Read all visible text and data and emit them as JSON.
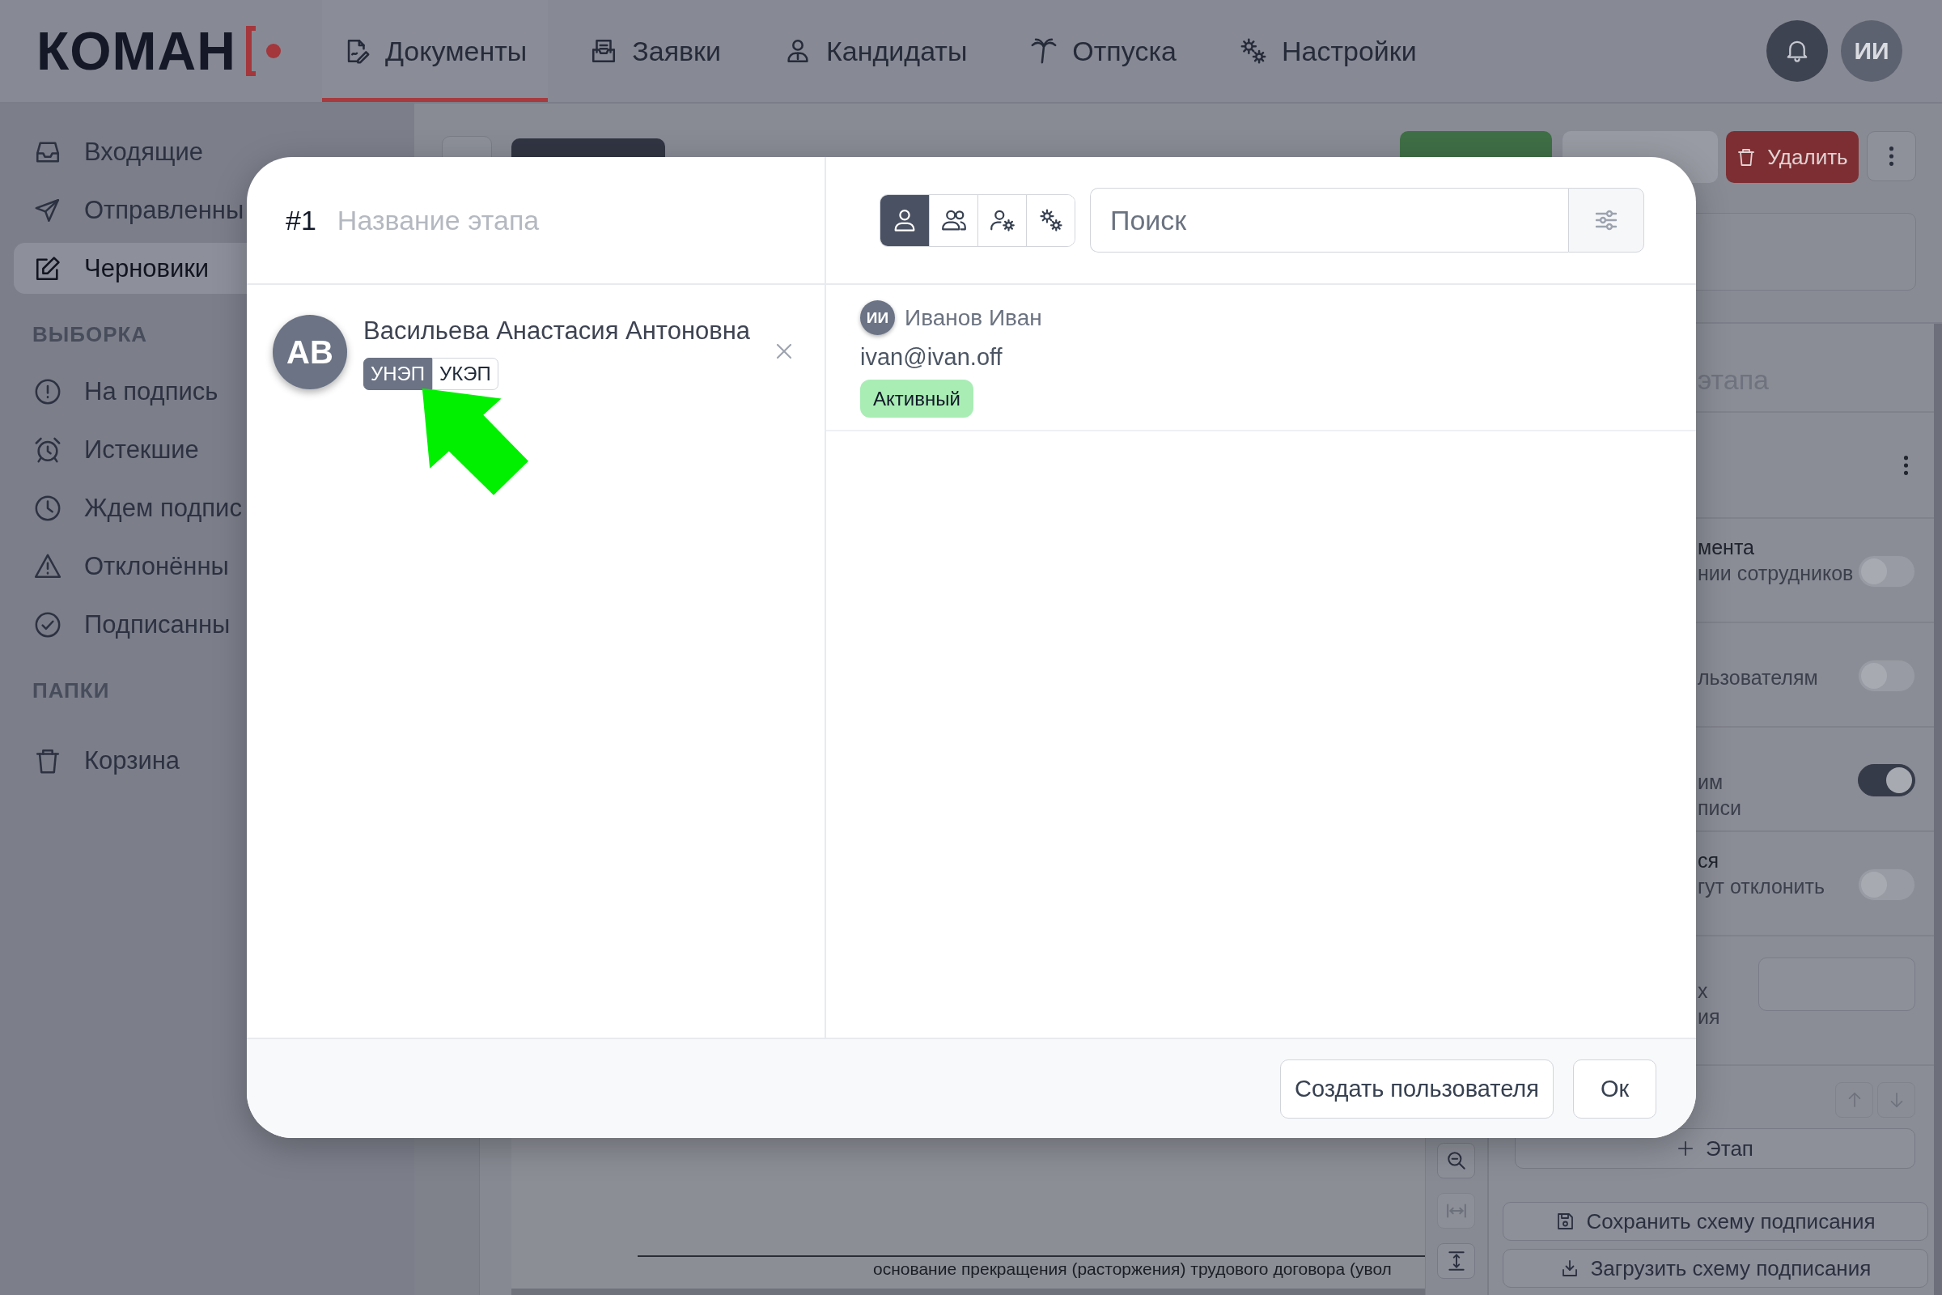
{
  "topbar": {
    "logo": "КОМАН",
    "nav": [
      {
        "label": "Документы",
        "selected": true
      },
      {
        "label": "Заявки",
        "selected": false
      },
      {
        "label": "Кандидаты",
        "selected": false
      },
      {
        "label": "Отпуска",
        "selected": false
      },
      {
        "label": "Настройки",
        "selected": false
      }
    ],
    "avatar": "ИИ"
  },
  "sidebar": {
    "groups": [
      {
        "items": [
          {
            "label": "Входящие",
            "selected": false
          },
          {
            "label": "Отправленны",
            "selected": false
          },
          {
            "label": "Черновики",
            "selected": true
          }
        ]
      },
      {
        "heading": "ВЫБОРКА",
        "items": [
          {
            "label": "На подпись",
            "selected": false
          },
          {
            "label": "Истекшие",
            "selected": false
          },
          {
            "label": "Ждем подпис",
            "selected": false
          },
          {
            "label": "Отклонённы",
            "selected": false
          },
          {
            "label": "Подписанны",
            "selected": false
          }
        ]
      },
      {
        "heading": "ПАПКИ",
        "items": [
          {
            "label": "Корзина",
            "selected": false
          }
        ]
      }
    ]
  },
  "toolbar": {
    "delete_label": "Удалить"
  },
  "document": {
    "text": "основание прекращения (расторжения) трудового договора (увол"
  },
  "stage_panel": {
    "title": "этапа",
    "options": [
      {
        "title": "мента",
        "description": [
          "нии сотрудников"
        ],
        "on": false
      },
      {
        "description": [
          "льзователям"
        ],
        "on": false
      },
      {
        "description": [
          "им",
          "писи"
        ],
        "on": true
      },
      {
        "title": "ся",
        "description": [
          "гут отклонить"
        ],
        "on": false
      }
    ],
    "field": {
      "description": [
        "х",
        "ия"
      ]
    },
    "add_stage": "Этап",
    "scheme_buttons": [
      "Сохранить схему подписания",
      "Загрузить схему подписания"
    ]
  },
  "modal": {
    "stage": {
      "number": "#1",
      "placeholder": "Название этапа"
    },
    "signers": [
      {
        "initials": "АВ",
        "name": "Васильева Анастасия Антоновна",
        "signature_types": [
          {
            "label": "УНЭП",
            "selected": true
          },
          {
            "label": "УКЭП",
            "selected": false
          }
        ]
      }
    ],
    "filter_modes": [
      {
        "selected": true
      },
      {
        "selected": false
      },
      {
        "selected": false
      },
      {
        "selected": false
      }
    ],
    "search": {
      "placeholder": "Поиск"
    },
    "users": [
      {
        "initials": "ИИ",
        "name": "Иванов Иван",
        "email": "ivan@ivan.off",
        "status": "Активный"
      }
    ],
    "buttons": [
      "Создать пользователя",
      "Ок"
    ]
  }
}
